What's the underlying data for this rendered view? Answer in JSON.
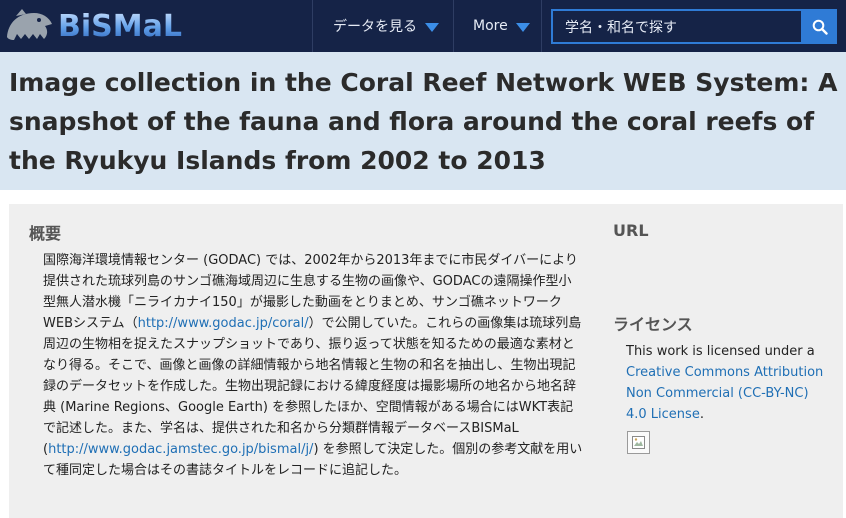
{
  "navbar": {
    "logo_text": "BiSMaL",
    "menu_data": "データを見る",
    "menu_more": "More",
    "search_placeholder": "学名・和名で探す"
  },
  "page": {
    "title": "Image collection in the Coral Reef Network WEB System: A snapshot of the fauna and flora around the coral reefs of the Ryukyu Islands from 2002 to 2013"
  },
  "abstract": {
    "heading": "概要",
    "text_1": "国際海洋環境情報センター (GODAC) では、2002年から2013年までに市民ダイバーにより提供された琉球列島のサンゴ礁海域周辺に生息する生物の画像や、GODACの遠隔操作型小型無人潜水機「ニライカナイ150」が撮影した動画をとりまとめ、サンゴ礁ネットワークWEBシステム（",
    "link_1": "http://www.godac.jp/coral/",
    "text_2": "）で公開していた。これらの画像集は琉球列島周辺の生物相を捉えたスナップショットであり、振り返って状態を知るための最適な素材となり得る。そこで、画像と画像の詳細情報から地名情報と生物の和名を抽出し、生物出現記録のデータセットを作成した。生物出現記録における緯度経度は撮影場所の地名から地名辞典 (Marine Regions、Google Earth) を参照したほか、空間情報がある場合にはWKT表記で記述した。また、学名は、提供された和名から分類群情報データベースBISMaL (",
    "link_2": "http://www.godac.jamstec.go.jp/bismal/j/",
    "text_3": ") を参照して決定した。個別の参考文献を用いて種同定した場合はその書誌タイトルをレコードに追記した。"
  },
  "url_section": {
    "heading": "URL"
  },
  "license": {
    "heading": "ライセンス",
    "text": "This work is licensed under a ",
    "link": "Creative Commons Attribution Non Commercial (CC-BY-NC) 4.0 License",
    "suffix": "."
  },
  "colors": {
    "navbar": "#152347",
    "accent": "#2f7bd6",
    "title_band": "#d9e6f2",
    "panel": "#efefef",
    "link": "#1f6fb5"
  }
}
